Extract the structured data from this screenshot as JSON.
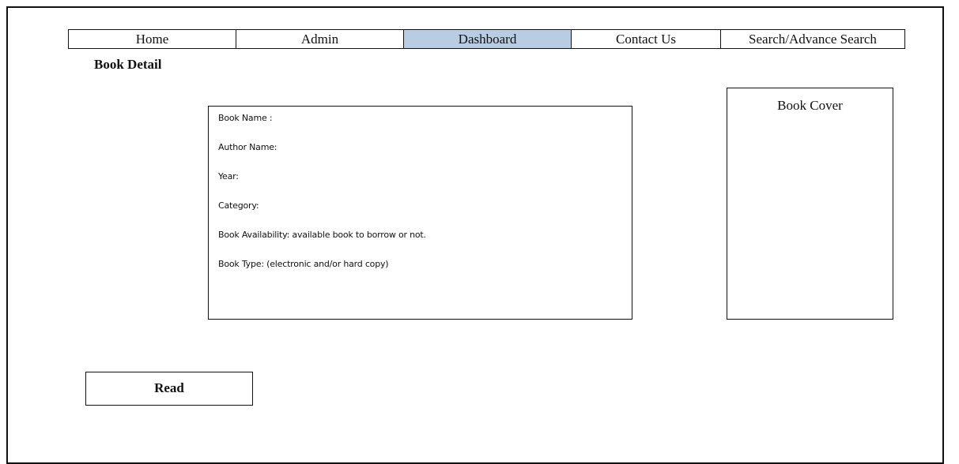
{
  "nav": {
    "items": [
      {
        "label": "Home"
      },
      {
        "label": "Admin"
      },
      {
        "label": "Dashboard"
      },
      {
        "label": "Contact Us"
      },
      {
        "label": "Search/Advance Search"
      }
    ],
    "active_color": "#b8cce4"
  },
  "page_title": "Book Detail",
  "details": {
    "lines": [
      "Book Name :",
      "Author Name:",
      "Year:",
      "Category:",
      "Book Availability: available book to borrow or not.",
      "Book Type: (electronic and/or hard copy)"
    ]
  },
  "cover": {
    "label": "Book Cover"
  },
  "read_button": {
    "label": "Read"
  }
}
